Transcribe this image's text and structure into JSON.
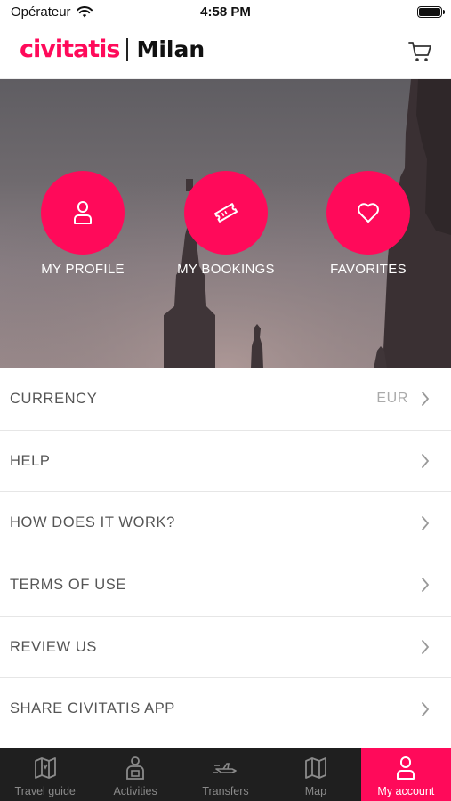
{
  "status_bar": {
    "carrier": "Opérateur",
    "time": "4:58 PM"
  },
  "header": {
    "brand": "civitatis",
    "city": "Milan",
    "cart_icon": "cart-icon"
  },
  "colors": {
    "accent": "#ff0a5a",
    "tab_bar_bg": "#1f1f1f",
    "menu_text": "#555555"
  },
  "hero": {
    "actions": [
      {
        "label": "MY PROFILE",
        "icon": "user-icon"
      },
      {
        "label": "MY BOOKINGS",
        "icon": "ticket-icon"
      },
      {
        "label": "FAVORITES",
        "icon": "heart-icon"
      }
    ]
  },
  "menu": {
    "items": [
      {
        "label": "CURRENCY",
        "value": "EUR"
      },
      {
        "label": "HELP"
      },
      {
        "label": "HOW DOES IT WORK?"
      },
      {
        "label": "TERMS OF USE"
      },
      {
        "label": "REVIEW US"
      },
      {
        "label": "SHARE CIVITATIS APP"
      }
    ]
  },
  "tabs": [
    {
      "label": "Travel guide",
      "icon": "map-book-icon"
    },
    {
      "label": "Activities",
      "icon": "activities-icon"
    },
    {
      "label": "Transfers",
      "icon": "transfers-icon"
    },
    {
      "label": "Map",
      "icon": "map-icon"
    },
    {
      "label": "My account",
      "icon": "account-icon",
      "active": true
    }
  ]
}
